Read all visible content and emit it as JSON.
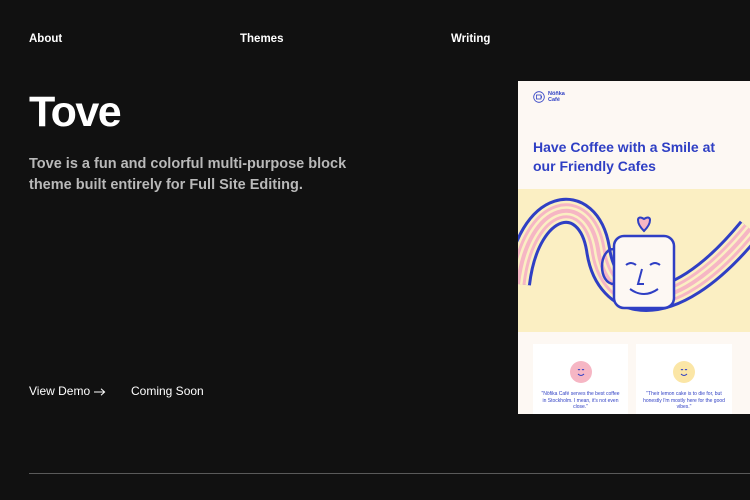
{
  "nav": {
    "about": "About",
    "themes": "Themes",
    "writing": "Writing"
  },
  "hero": {
    "title": "Tove",
    "description": "Tove is a fun and colorful multi-purpose block theme built entirely for Full Site Editing."
  },
  "actions": {
    "view_demo": "View Demo",
    "coming_soon": "Coming Soon"
  },
  "preview": {
    "brand_line1": "Nöñka",
    "brand_line2": "Café",
    "heading": "Have Coffee with a Smile at our Friendly Cafes",
    "cards": [
      {
        "quote": "\"Nöfika Café serves the best coffee in Stockholm. I mean, it's not even close.\""
      },
      {
        "quote": "\"Their lemon cake is to die for, but honestly I'm mostly here for the good vibes.\""
      }
    ]
  },
  "colors": {
    "background": "#111111",
    "text": "#ffffff",
    "muted_text": "#b9b9b9",
    "preview_blue": "#2f3fc4",
    "preview_pink": "#f6b6c4",
    "preview_yellow": "#fbefc3"
  },
  "icons": {
    "arrow": "arrow-right-icon",
    "logo": "mug-logo-icon"
  }
}
